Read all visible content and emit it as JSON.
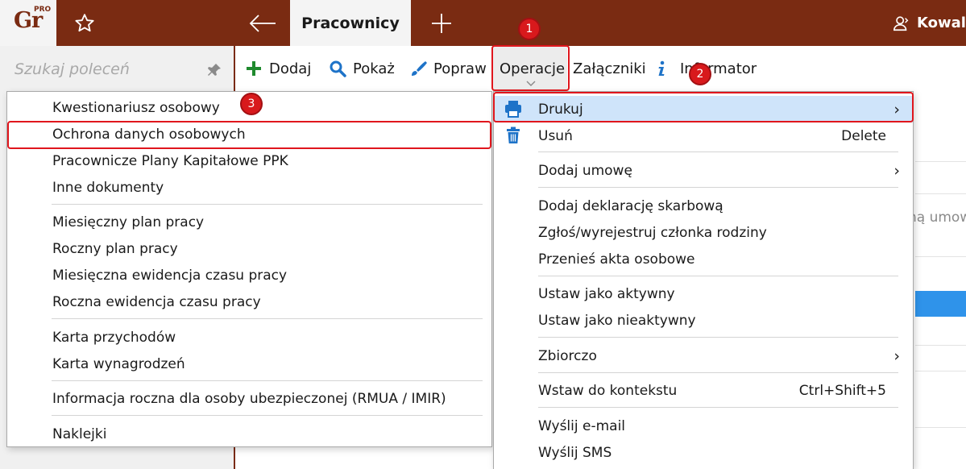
{
  "app": {
    "logo_text": "Gr",
    "logo_badge": "PRO"
  },
  "tabs": {
    "active_label": "Pracownicy"
  },
  "user": {
    "name": "Kowal"
  },
  "sidebar": {
    "search_placeholder": "Szukaj poleceń"
  },
  "toolbar": {
    "items": [
      {
        "label": "Dodaj",
        "icon": "plus-icon"
      },
      {
        "label": "Pokaż",
        "icon": "search-icon"
      },
      {
        "label": "Popraw",
        "icon": "brush-icon"
      },
      {
        "label": "Operacje"
      },
      {
        "label": "Załączniki"
      },
      {
        "label": "Informator",
        "icon": "info-icon"
      }
    ]
  },
  "operations_menu": {
    "items": [
      {
        "label": "Drukuj",
        "icon": "printer-icon",
        "has_submenu": true,
        "highlighted": true
      },
      {
        "label": "Usuń",
        "icon": "trash-icon",
        "shortcut": "Delete"
      },
      {
        "label": "Dodaj umowę",
        "has_submenu": true
      },
      {
        "label": "Dodaj deklarację skarbową"
      },
      {
        "label": "Zgłoś/wyrejestruj członka rodziny"
      },
      {
        "label": "Przenieś akta osobowe"
      },
      {
        "label": "Ustaw jako aktywny"
      },
      {
        "label": "Ustaw jako nieaktywny"
      },
      {
        "label": "Zbiorczo",
        "has_submenu": true
      },
      {
        "label": "Wstaw do kontekstu",
        "shortcut": "Ctrl+Shift+5"
      },
      {
        "label": "Wyślij e-mail"
      },
      {
        "label": "Wyślij SMS"
      }
    ]
  },
  "print_submenu": {
    "items": [
      {
        "label": "Kwestionariusz osobowy"
      },
      {
        "label": "Ochrona danych osobowych",
        "annotated": true
      },
      {
        "label": "Pracownicze Plany Kapitałowe PPK"
      },
      {
        "label": "Inne dokumenty"
      },
      {
        "label": "Miesięczny plan pracy"
      },
      {
        "label": "Roczny plan pracy"
      },
      {
        "label": "Miesięczna ewidencja czasu pracy"
      },
      {
        "label": "Roczna ewidencja czasu pracy"
      },
      {
        "label": "Karta przychodów"
      },
      {
        "label": "Karta wynagrodzeń"
      },
      {
        "label": "Informacja roczna dla osoby ubezpieczonej (RMUA / IMIR)"
      },
      {
        "label": "Naklejki"
      }
    ]
  },
  "background": {
    "partial_text": "ną umow"
  },
  "annotations": [
    {
      "label": "1"
    },
    {
      "label": "2"
    },
    {
      "label": "3"
    }
  ],
  "colors": {
    "brand": "#7a2b12",
    "highlight": "#cfe4fa",
    "annotation": "#e0161d",
    "accent_blue": "#1e73c8",
    "green": "#1f8a2e"
  }
}
